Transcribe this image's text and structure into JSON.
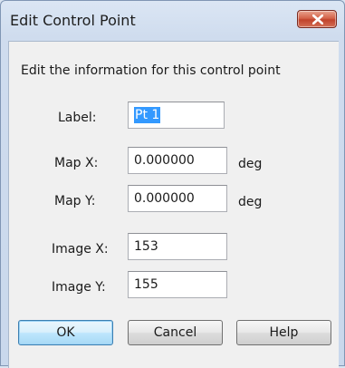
{
  "window": {
    "title": "Edit Control Point",
    "close_label": "close"
  },
  "dialog": {
    "instruction": "Edit the information for this control point",
    "fields": {
      "label": {
        "label": "Label:",
        "value": "Pt 1"
      },
      "map_x": {
        "label": "Map X:",
        "value": "0.000000",
        "unit": "deg"
      },
      "map_y": {
        "label": "Map Y:",
        "value": "0.000000",
        "unit": "deg"
      },
      "image_x": {
        "label": "Image X:",
        "value": "153"
      },
      "image_y": {
        "label": "Image Y:",
        "value": "155"
      }
    },
    "buttons": {
      "ok": "OK",
      "cancel": "Cancel",
      "help": "Help"
    }
  },
  "colors": {
    "selection": "#3399ff",
    "close_button": "#c1432c"
  }
}
